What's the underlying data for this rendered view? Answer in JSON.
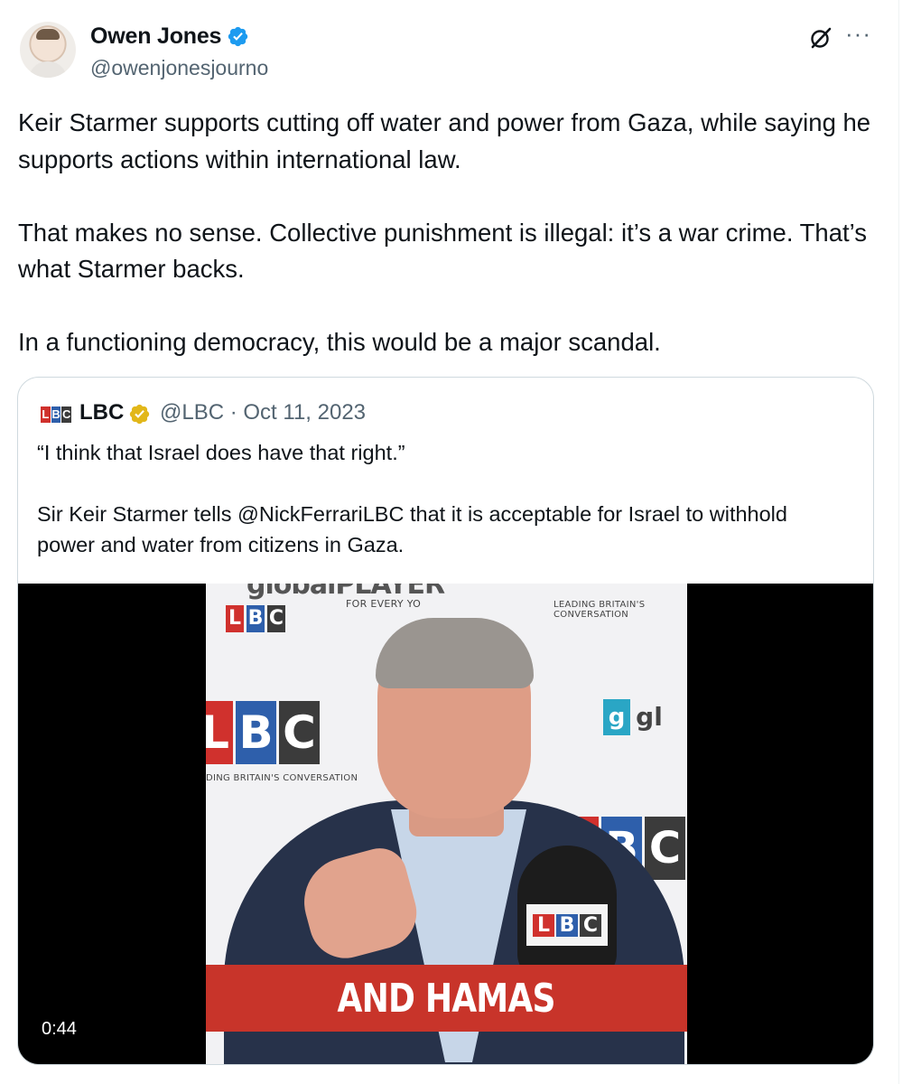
{
  "author": {
    "name": "Owen Jones",
    "handle": "@owenjonesjourno",
    "verified_icon": "verified-badge-blue",
    "colors": {
      "verified": "#1d9bf0"
    }
  },
  "actions": {
    "grok_icon": "grok-icon",
    "more_label": "···"
  },
  "tweet": {
    "paragraphs": [
      "Keir Starmer supports cutting off water and power from Gaza, while saying he supports actions within international law.",
      "That makes no sense. Collective punishment is illegal: it’s a war crime. That’s what Starmer backs.",
      "In a functioning democracy, this would be a major scandal."
    ]
  },
  "quoted_tweet": {
    "logo_letters": [
      "L",
      "B",
      "C"
    ],
    "name": "LBC",
    "verified_icon": "verified-badge-gold",
    "meta": "@LBC · Oct 11, 2023",
    "paragraphs": [
      "“I think that Israel does have that right.”",
      "Sir Keir Starmer tells @NickFerrariLBC that it is acceptable for Israel to withhold power and water from citizens in Gaza."
    ],
    "video": {
      "caption": "AND HAMAS",
      "duration": "0:44",
      "backdrop": {
        "brand_top": "globalPLAYER",
        "for_every": "FOR EVERY YO",
        "tagline": "LEADING BRITAIN'S CONVERSATION",
        "tagline_partial": "DING BRITAIN'S CONVERSATION",
        "lbc_letters": [
          "L",
          "B",
          "C"
        ],
        "global_partial": "gl"
      },
      "colors": {
        "caption_bar": "#c8342a",
        "lbc_red": "#d0312d",
        "lbc_blue": "#2e5fab",
        "lbc_grey": "#3b3b3b"
      }
    }
  }
}
